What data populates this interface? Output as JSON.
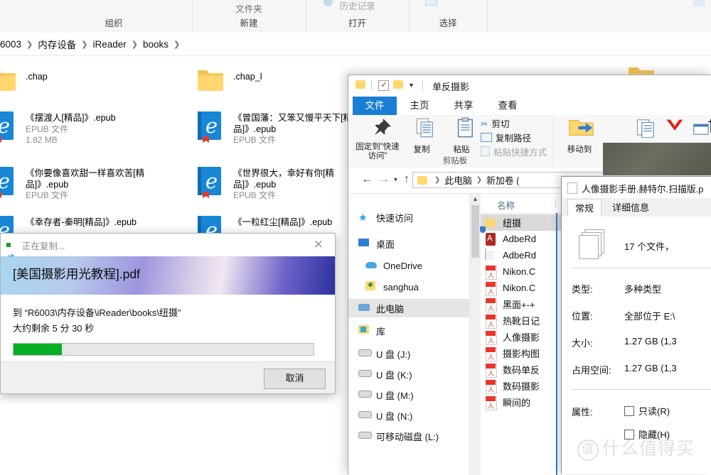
{
  "background_explorer": {
    "ribbon_groups": [
      {
        "label": "组织"
      },
      {
        "label": "新建",
        "mini": "文件夹"
      },
      {
        "label": "打开",
        "mini": "历史记录"
      },
      {
        "label": "选择"
      }
    ],
    "breadcrumb": [
      "6003",
      "内存设备",
      "iReader",
      "books"
    ],
    "tiles": [
      {
        "icon": "folder-icon",
        "name": ".chap",
        "type": "",
        "size": ""
      },
      {
        "icon": "epub-icon",
        "name": "《摆渡人[精品]》.epub",
        "type": "EPUB 文件",
        "size": "1.82 MB"
      },
      {
        "icon": "epub-icon",
        "name": "《你要像喜欢甜一样喜欢苦[精品]》.epub",
        "type": "EPUB 文件",
        "size": ""
      },
      {
        "icon": "epub-icon",
        "name": "《幸存者-秦明[精品]》.epub",
        "type": "",
        "size": ""
      },
      {
        "icon": "folder-icon",
        "name": ".chap_l",
        "type": "",
        "size": ""
      },
      {
        "icon": "epub-icon",
        "name": "《曾国藩：又笨又慢平天下[精品]》.epub",
        "type": "EPUB 文件",
        "size": ""
      },
      {
        "icon": "epub-icon",
        "name": "《世界很大，幸好有你[精品]》.epub",
        "type": "EPUB 文件",
        "size": ""
      },
      {
        "icon": "epub-icon",
        "name": "《一粒红尘[精品]》.epub",
        "type": "",
        "size": ""
      }
    ]
  },
  "copy_dialog": {
    "title": "正在复制...",
    "close_label": "✕",
    "file_name": "[美国摄影用光教程].pdf",
    "destination_line": "到 “R6003\\内存设备\\iReader\\books\\纽摄”",
    "time_remaining_line": "大约剩余 5 分 30 秒",
    "progress_percent": 16,
    "progress_color": "#06b025",
    "cancel_label": "取消"
  },
  "explorer_window": {
    "quick_access_title": "单反摄影",
    "quick_access_icons": [
      "folder-icon",
      "checkmark-icon",
      "folder-icon",
      "chevron-down-icon"
    ],
    "tabs": [
      {
        "label": "文件",
        "active": true
      },
      {
        "label": "主页",
        "active": false
      },
      {
        "label": "共享",
        "active": false
      },
      {
        "label": "查看",
        "active": false
      }
    ],
    "ribbon": {
      "clipboard_group_label": "剪贴板",
      "pin_label": "固定到\"快速访问\"",
      "copy_label": "复制",
      "paste_label": "粘贴",
      "cut_label": "剪切",
      "copy_path_label": "复制路径",
      "paste_shortcut_label": "粘贴快捷方式",
      "move_to_label": "移动到"
    },
    "nav": {
      "back_icon": "arrow-left-icon",
      "forward_icon": "arrow-right-icon",
      "recent_icon": "chevron-down-icon",
      "up_icon": "arrow-up-icon",
      "address_parts": [
        "此电脑",
        "新加卷 ("
      ]
    },
    "tree_items": [
      {
        "label": "快速访问",
        "icon": "star-icon",
        "selected": false
      },
      {
        "label": "桌面",
        "icon": "desktop-icon",
        "selected": false
      },
      {
        "label": "OneDrive",
        "icon": "cloud-icon",
        "selected": false
      },
      {
        "label": "sanghua",
        "icon": "user-icon",
        "selected": false
      },
      {
        "label": "此电脑",
        "icon": "computer-icon",
        "selected": true
      },
      {
        "label": "库",
        "icon": "library-icon",
        "selected": false
      },
      {
        "label": "U 盘 (J:)",
        "icon": "usb-drive-icon",
        "selected": false
      },
      {
        "label": "U 盘 (K:)",
        "icon": "usb-drive-icon",
        "selected": false
      },
      {
        "label": "U 盘 (M:)",
        "icon": "usb-drive-icon",
        "selected": false
      },
      {
        "label": "U 盘 (N:)",
        "icon": "usb-drive-icon",
        "selected": false
      },
      {
        "label": "可移动磁盘 (L:)",
        "icon": "usb-drive-icon",
        "selected": false
      }
    ],
    "list_column_header": "名称",
    "list_rows": [
      {
        "name": "纽摄",
        "icon": "folder-icon",
        "selected": true
      },
      {
        "name": "AdbeRd",
        "icon": "acrobat-icon",
        "selected": false
      },
      {
        "name": "AdbeRd",
        "icon": "document-icon",
        "selected": false
      },
      {
        "name": "Nikon.C",
        "icon": "pdf-icon",
        "selected": false
      },
      {
        "name": "Nikon.C",
        "icon": "pdf-icon",
        "selected": false
      },
      {
        "name": "黑面+-+",
        "icon": "pdf-icon",
        "selected": false
      },
      {
        "name": "热靴日记",
        "icon": "pdf-icon",
        "selected": false
      },
      {
        "name": "人像摄影",
        "icon": "pdf-icon",
        "selected": false
      },
      {
        "name": "摄影构图",
        "icon": "pdf-icon",
        "selected": false
      },
      {
        "name": "数码单反",
        "icon": "pdf-icon",
        "selected": false
      },
      {
        "name": "数码摄影",
        "icon": "pdf-icon",
        "selected": false
      },
      {
        "name": "瞬间的",
        "icon": "pdf-icon",
        "selected": false
      }
    ]
  },
  "properties_dialog": {
    "title": "人像摄影手册.赫特尔.扫描版.p",
    "tabs": [
      {
        "label": "常规",
        "active": true
      },
      {
        "label": "详细信息",
        "active": false
      }
    ],
    "summary": "17 个文件，",
    "fields": [
      {
        "label": "类型:",
        "value": "多种类型"
      },
      {
        "label": "位置:",
        "value": "全部位于 E:\\"
      },
      {
        "label": "大小:",
        "value": "1.27 GB (1,3"
      },
      {
        "label": "占用空间:",
        "value": "1.27 GB (1,3"
      }
    ],
    "attributes_label": "属性:",
    "checkboxes": [
      {
        "label": "只读(R)",
        "checked": false
      },
      {
        "label": "隐藏(H)",
        "checked": false
      }
    ]
  },
  "watermark": {
    "mark": "值",
    "text": "什么值得买"
  }
}
